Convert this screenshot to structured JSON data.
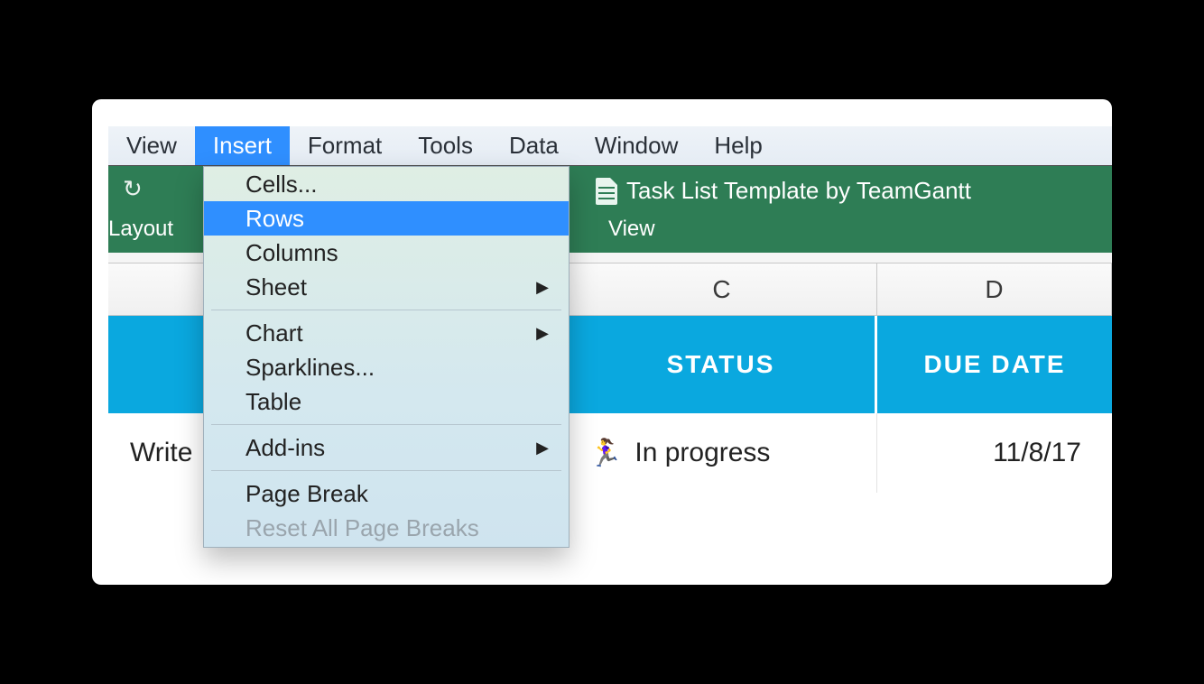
{
  "menubar": {
    "items": [
      {
        "label": "View",
        "active": false
      },
      {
        "label": "Insert",
        "active": true
      },
      {
        "label": "Format",
        "active": false
      },
      {
        "label": "Tools",
        "active": false
      },
      {
        "label": "Data",
        "active": false
      },
      {
        "label": "Window",
        "active": false
      },
      {
        "label": "Help",
        "active": false
      }
    ]
  },
  "toolbar": {
    "layout_label": "Layout",
    "view_label": "View",
    "document_title": "Task List Template by TeamGantt"
  },
  "dropdown": {
    "cells": "Cells...",
    "rows": "Rows",
    "columns": "Columns",
    "sheet": "Sheet",
    "chart": "Chart",
    "sparklines": "Sparklines...",
    "table": "Table",
    "addins": "Add-ins",
    "page_break": "Page Break",
    "reset_breaks": "Reset All Page Breaks"
  },
  "columns": {
    "c": "C",
    "d": "D"
  },
  "headers": {
    "status": "STATUS",
    "due_date": "DUE DATE"
  },
  "row1": {
    "task": "Write",
    "status_icon": "🏃‍♀️",
    "status_text": "In progress",
    "due_date": "11/8/17"
  }
}
